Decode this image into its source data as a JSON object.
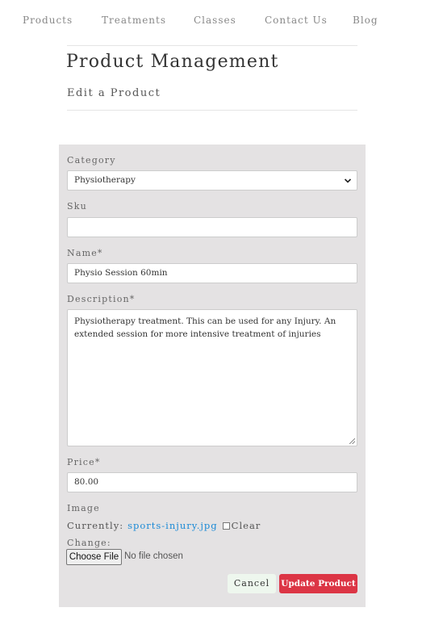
{
  "nav": {
    "items": [
      {
        "label": "Products"
      },
      {
        "label": "Treatments"
      },
      {
        "label": "Classes"
      },
      {
        "label": "Contact Us"
      },
      {
        "label": "Blog"
      }
    ]
  },
  "header": {
    "title": "Product Management",
    "subtitle": "Edit a Product"
  },
  "form": {
    "category": {
      "label": "Category",
      "selected": "Physiotherapy"
    },
    "sku": {
      "label": "Sku",
      "value": ""
    },
    "name": {
      "label": "Name*",
      "value": "Physio Session 60min"
    },
    "description": {
      "label": "Description*",
      "value": "Physiotherapy treatment. This can be used for any Injury. An extended session for more intensive treatment of injuries"
    },
    "price": {
      "label": "Price*",
      "value": "80.00"
    },
    "image": {
      "label": "Image",
      "currently_label": "Currently:",
      "current_file": "sports-injury.jpg",
      "clear_label": "Clear",
      "change_label": "Change:",
      "choose_file_label": "Choose File",
      "file_status": "No file chosen"
    },
    "buttons": {
      "cancel_label": "Cancel",
      "update_label": "Update Product"
    }
  },
  "colors": {
    "panel_bg": "#e4e2e3",
    "primary_button": "#dc3545",
    "cancel_button": "#eef7ee",
    "link": "#1b8ad6"
  }
}
